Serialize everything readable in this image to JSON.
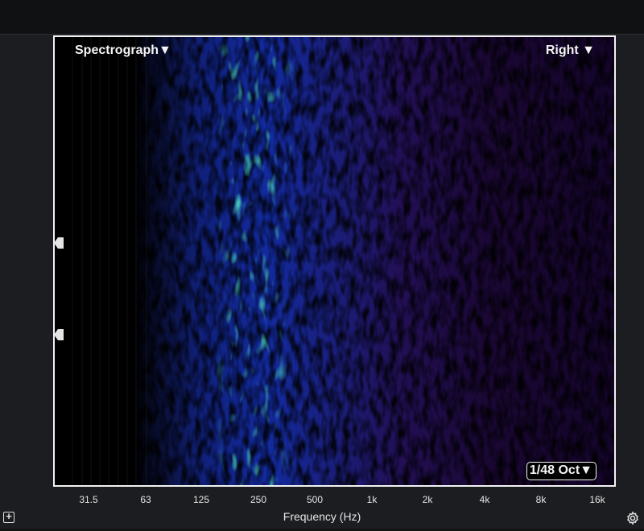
{
  "display": {
    "mode_label": "Spectrograph",
    "channel_label": "Right",
    "resolution_label": "1/48 Oct",
    "dropdown_glyph": "▼"
  },
  "x_axis": {
    "title": "Frequency (Hz)",
    "ticks": [
      "31.5",
      "63",
      "125",
      "250",
      "500",
      "1k",
      "2k",
      "4k",
      "8k",
      "16k"
    ]
  },
  "controls": {
    "add_glyph": "+",
    "settings_icon": "gear-icon",
    "marker_icon": "slider-handle-icon"
  },
  "colors": {
    "background": "#000000",
    "low_energy": "#2a0a4a",
    "mid_energy": "#1c2ec0",
    "high_energy": "#18e07a",
    "frame": "#f2f2f2"
  }
}
